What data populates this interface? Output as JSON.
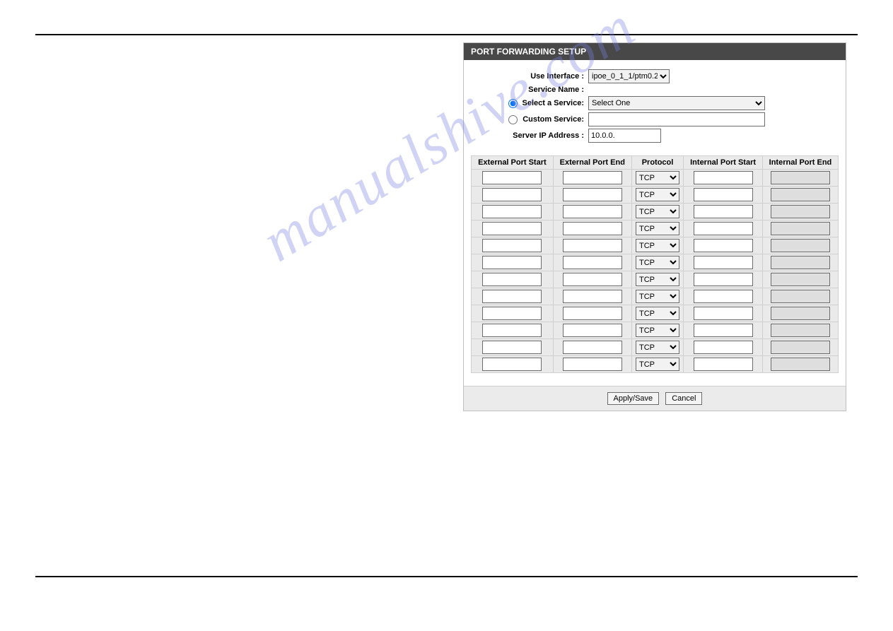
{
  "watermark_text": "manualshive.com",
  "panel": {
    "title": "PORT FORWARDING SETUP",
    "use_interface_label": "Use Interface :",
    "use_interface_value": "ipoe_0_1_1/ptm0.2",
    "service_name_label": "Service Name :",
    "select_service_label": "Select a Service:",
    "select_service_value": "Select One",
    "custom_service_label": "Custom Service:",
    "custom_service_value": "",
    "server_ip_label": "Server IP Address :",
    "server_ip_value": "10.0.0."
  },
  "columns": {
    "ext_start": "External Port Start",
    "ext_end": "External Port End",
    "protocol": "Protocol",
    "int_start": "Internal Port Start",
    "int_end": "Internal Port End"
  },
  "protocol_default": "TCP",
  "row_count": 12,
  "buttons": {
    "apply": "Apply/Save",
    "cancel": "Cancel"
  }
}
